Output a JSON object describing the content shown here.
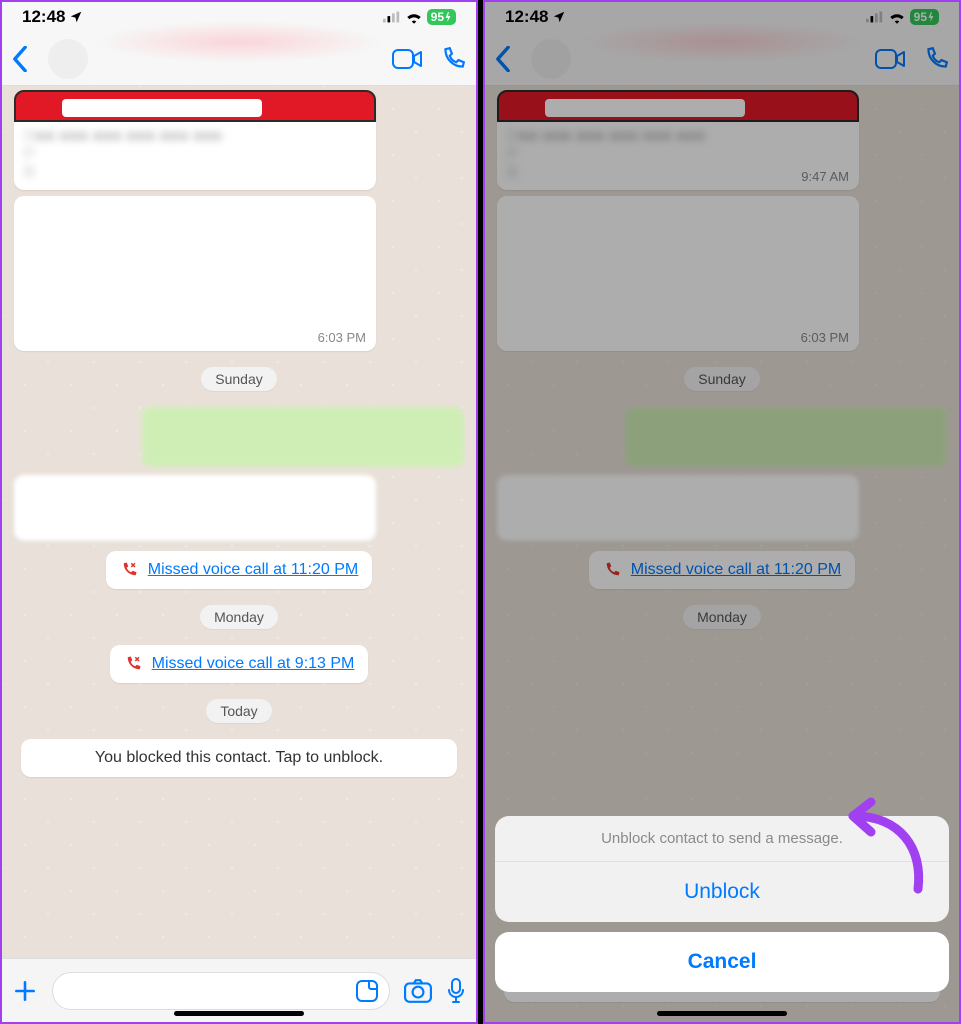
{
  "status": {
    "time": "12:48",
    "battery": "95"
  },
  "messages": {
    "time1": "6:03 PM",
    "time2": "9:47 AM"
  },
  "dates": {
    "sunday": "Sunday",
    "monday": "Monday",
    "today": "Today"
  },
  "calls": {
    "missed1": "Missed voice call at 11:20 PM",
    "missed2": "Missed voice call at 9:13 PM"
  },
  "blocked": {
    "banner": "You blocked this contact. Tap to unblock."
  },
  "sheet": {
    "message": "Unblock contact to send a message.",
    "unblock": "Unblock",
    "cancel": "Cancel"
  }
}
